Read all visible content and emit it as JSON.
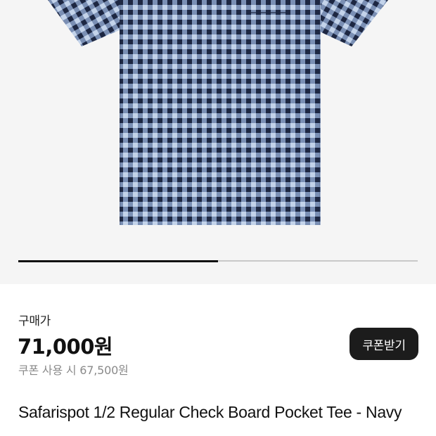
{
  "product": {
    "image_alt": "check-board-pocket-tee-photo",
    "colors": {
      "navy": "#1f2a44",
      "light_blue": "#b8cbe6",
      "mid_blue": "#6f86ad",
      "background": "#f5f5f5"
    }
  },
  "carousel": {
    "progress_fraction": 0.5
  },
  "pricing": {
    "label": "구매가",
    "price": "71,000원",
    "coupon_price": "쿠폰 사용 시 67,500원",
    "coupon_button_label": "쿠폰받기"
  },
  "title": "Safarispot 1/2 Regular Check Board Pocket Tee - Navy"
}
